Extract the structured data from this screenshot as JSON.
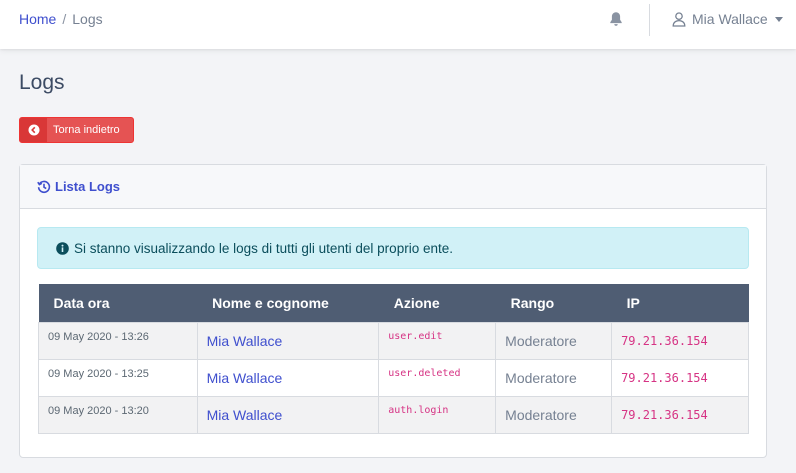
{
  "breadcrumb": {
    "home": "Home",
    "separator": "/",
    "current": "Logs"
  },
  "user": {
    "name": "Mia Wallace"
  },
  "page": {
    "title": "Logs"
  },
  "back_button": {
    "label": "Torna indietro"
  },
  "card": {
    "title": "Lista Logs"
  },
  "alert": {
    "text": "Si stanno visualizzando le logs di tutti gli utenti del proprio ente."
  },
  "table": {
    "columns": [
      "Data ora",
      "Nome e cognome",
      "Azione",
      "Rango",
      "IP"
    ],
    "rows": [
      {
        "datetime": "09 May 2020 - 13:26",
        "name": "Mia Wallace",
        "action": "user.edit",
        "role": "Moderatore",
        "ip": "79.21.36.154"
      },
      {
        "datetime": "09 May 2020 - 13:25",
        "name": "Mia Wallace",
        "action": "user.deleted",
        "role": "Moderatore",
        "ip": "79.21.36.154"
      },
      {
        "datetime": "09 May 2020 - 13:20",
        "name": "Mia Wallace",
        "action": "auth.login",
        "role": "Moderatore",
        "ip": "79.21.36.154"
      }
    ]
  },
  "colors": {
    "accent": "#3f4fce",
    "danger": "#e55353",
    "info_bg": "#d1f1f7",
    "table_head": "#4f5d73",
    "code": "#d63384"
  },
  "icons": {
    "notifications": "bell-icon",
    "user": "user-icon",
    "back": "arrow-circle-left-icon",
    "history": "history-icon",
    "info": "info-circle-icon"
  }
}
